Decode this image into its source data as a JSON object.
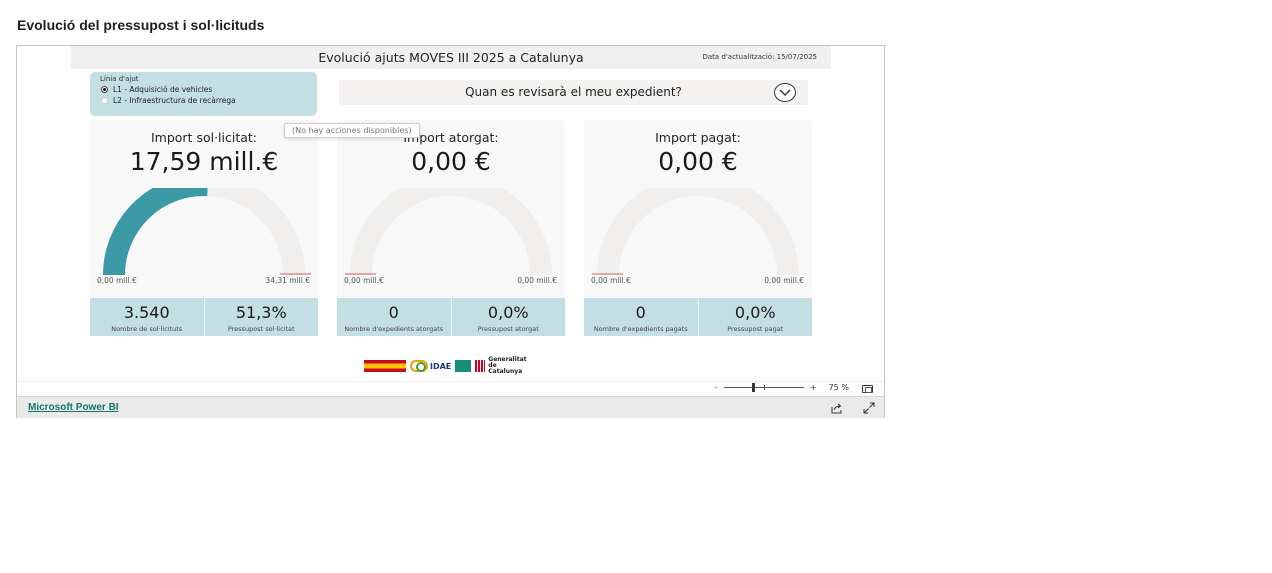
{
  "page": {
    "heading": "Evolució del pressupost i sol·licituds"
  },
  "report": {
    "title": "Evolució ajuts MOVES III 2025 a Catalunya",
    "update_date": "Data d'actualització: 15/07/2025",
    "line_filter": {
      "label": "Línia d'ajut",
      "options": [
        {
          "label": "L1 - Adquisició de vehicles",
          "selected": true
        },
        {
          "label": "L2 - Infraestructura de recàrrega",
          "selected": false
        }
      ]
    },
    "faq": {
      "label": "Quan es revisarà el meu expedient?",
      "icon": "chevron-down-icon"
    },
    "tooltip": "(No hay acciones disponibles)",
    "cards": [
      {
        "title": "Import sol·licitat:",
        "value": "17,59 mill.€",
        "gauge_min": "0,00 mill.€",
        "gauge_max": "34,31 mill.€",
        "gauge_fraction": 0.513,
        "stats": [
          {
            "value": "3.540",
            "label": "Nombre de sol·licituts"
          },
          {
            "value": "51,3%",
            "label": "Pressupost sol·licitat"
          }
        ]
      },
      {
        "title": "Import atorgat:",
        "value": "0,00 €",
        "gauge_min": "0,00 mill.€",
        "gauge_max": "0,00 mill.€",
        "gauge_fraction": 0,
        "stats": [
          {
            "value": "0",
            "label": "Nombre d'expedients atorgats"
          },
          {
            "value": "0,0%",
            "label": "Pressupost atorgat"
          }
        ]
      },
      {
        "title": "Import pagat:",
        "value": "0,00 €",
        "gauge_min": "0,00 mill.€",
        "gauge_max": "0,00 mill.€",
        "gauge_fraction": 0,
        "stats": [
          {
            "value": "0",
            "label": "Nombre d'expedients pagats"
          },
          {
            "value": "0,0%",
            "label": "Pressupost pagat"
          }
        ]
      }
    ],
    "logos": {
      "idae": "IDAE",
      "gencat": "Generalitat de Catalunya"
    },
    "colors": {
      "gauge_fill": "#3b9aa6",
      "gauge_track": "#f0efee",
      "target_line": "#e05a5a",
      "panel": "#c3dfe4"
    }
  },
  "zoom": {
    "minus": "-",
    "plus": "+",
    "level": "75 %"
  },
  "footer": {
    "link": "Microsoft Power BI"
  }
}
